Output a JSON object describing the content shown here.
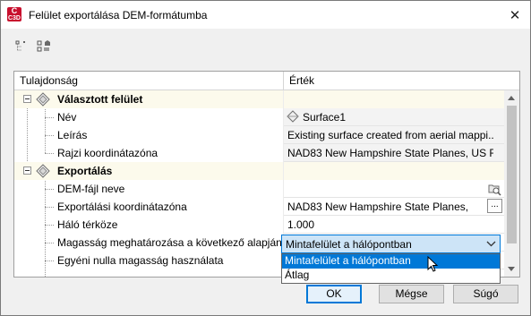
{
  "window": {
    "title": "Felület exportálása DEM-formátumba",
    "app_icon_top": "C",
    "app_icon_bottom": "C3D",
    "close_glyph": "✕"
  },
  "toolbar": {
    "icons": [
      "categorized-view-icon",
      "alphabetical-view-icon"
    ]
  },
  "grid": {
    "columns": [
      "Tulajdonság",
      "Érték"
    ],
    "categories": [
      {
        "label": "Választott felület",
        "icon": "surface-category-icon",
        "rows": [
          {
            "label": "Név",
            "value": "Surface1",
            "icon": "surface-icon"
          },
          {
            "label": "Leírás",
            "value": "Existing surface created from aerial mappi..."
          },
          {
            "label": "Rajzi koordinátazóna",
            "value": "NAD83 New Hampshire State Planes, US F..."
          }
        ]
      },
      {
        "label": "Exportálás",
        "icon": "export-category-icon",
        "rows": [
          {
            "label": "DEM-fájl neve",
            "value": "",
            "icon": "browse-file-icon"
          },
          {
            "label": "Exportálási koordinátazóna",
            "value": "NAD83 New Hampshire State Planes, U...",
            "button": "..."
          },
          {
            "label": "Háló térköze",
            "value": "1.000"
          },
          {
            "label": "Magasság meghatározása a következő alapján:",
            "value": "Mintafelület a hálópontban"
          },
          {
            "label": "Egyéni nulla magasság használata",
            "value": ""
          }
        ]
      }
    ]
  },
  "dropdown": {
    "selected": "Mintafelület a hálópontban",
    "options": [
      "Mintafelület a hálópontban",
      "Átlag"
    ]
  },
  "buttons": {
    "ok": "OK",
    "cancel": "Mégse",
    "help": "Súgó"
  },
  "colors": {
    "accent": "#0078d7",
    "selection_bg": "#cde4f7",
    "category_bg": "#fcfaec",
    "app_icon": "#c8102e"
  }
}
